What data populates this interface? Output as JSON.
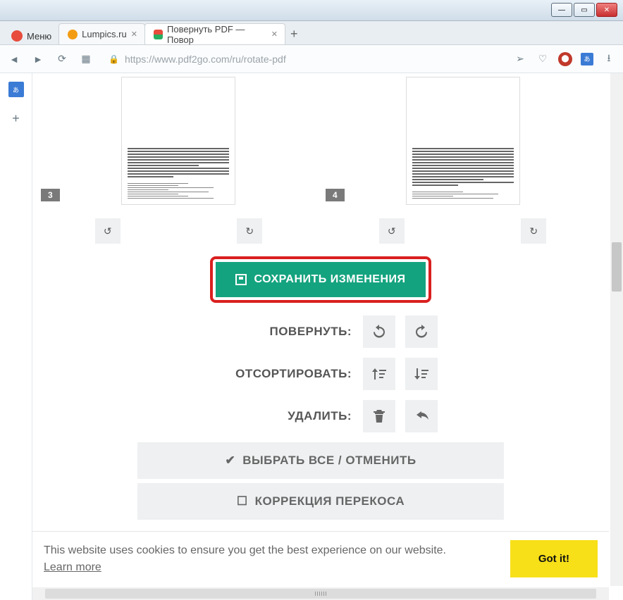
{
  "window": {
    "menu": "Меню"
  },
  "tabs": {
    "t0": {
      "label": "Lumpics.ru"
    },
    "t1": {
      "label": "Повернуть PDF — Повор"
    }
  },
  "address": {
    "url": "https://www.pdf2go.com/ru/rotate-pdf"
  },
  "pages": {
    "p3": "3",
    "p4": "4"
  },
  "save": {
    "label": "СОХРАНИТЬ ИЗМЕНЕНИЯ"
  },
  "actions": {
    "rotate": "ПОВЕРНУТЬ:",
    "sort": "ОТСОРТИРОВАТЬ:",
    "delete": "УДАЛИТЬ:",
    "selectall": "ВЫБРАТЬ ВСЕ / ОТМЕНИТЬ",
    "deskew": "КОРРЕКЦИЯ ПЕРЕКОСА"
  },
  "cookie": {
    "text": "This website uses cookies to ensure you get the best experience on our website.",
    "learn": "Learn more",
    "gotit": "Got it!"
  }
}
